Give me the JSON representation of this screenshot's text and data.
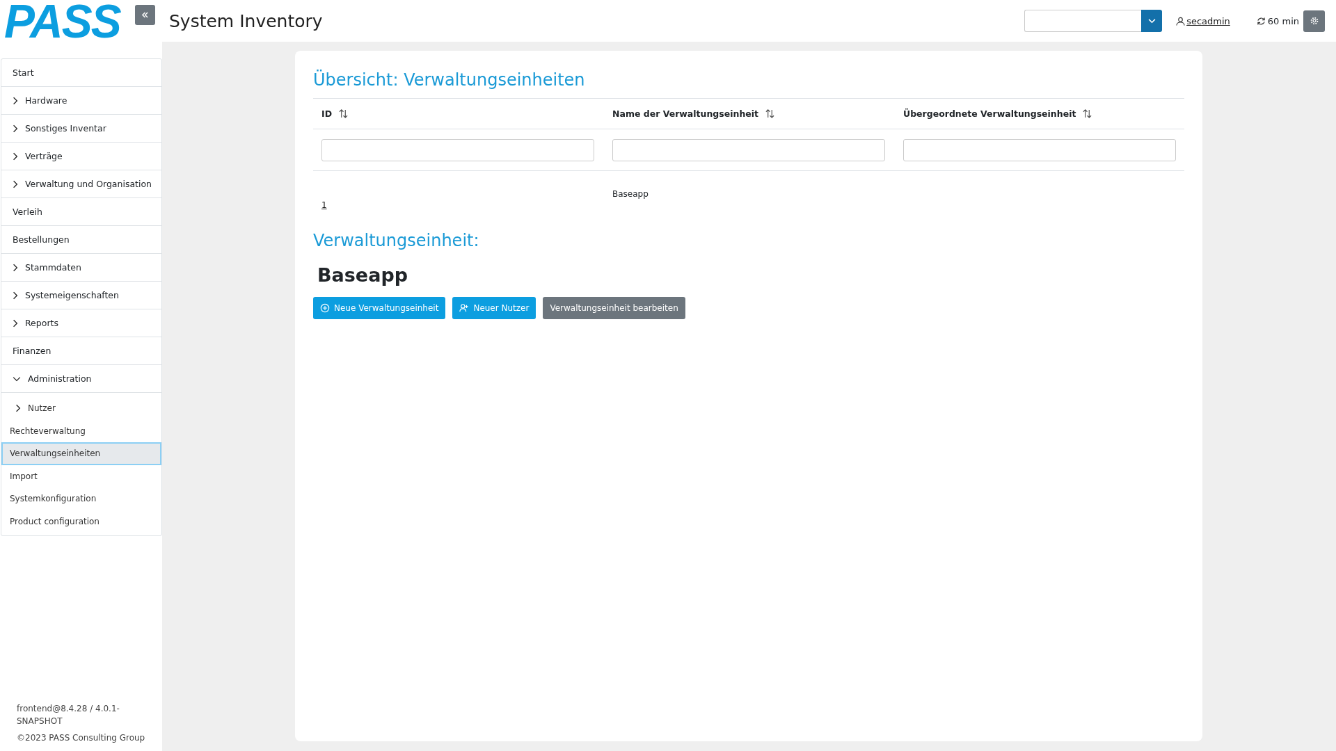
{
  "logo": "PASS",
  "header": {
    "title": "System Inventory",
    "user": "secadmin",
    "session": "60 min"
  },
  "sidebar": {
    "items": [
      {
        "label": "Start",
        "kind": "link",
        "selected": false
      },
      {
        "label": "Hardware",
        "kind": "group",
        "expanded": false,
        "selected": false
      },
      {
        "label": "Sonstiges Inventar",
        "kind": "group",
        "expanded": false,
        "selected": false
      },
      {
        "label": "Verträge",
        "kind": "group",
        "expanded": false,
        "selected": false
      },
      {
        "label": "Verwaltung und Organisation",
        "kind": "group",
        "expanded": false,
        "selected": false
      },
      {
        "label": "Verleih",
        "kind": "link",
        "selected": false
      },
      {
        "label": "Bestellungen",
        "kind": "link",
        "selected": false
      },
      {
        "label": "Stammdaten",
        "kind": "group",
        "expanded": false,
        "selected": false
      },
      {
        "label": "Systemeigenschaften",
        "kind": "group",
        "expanded": false,
        "selected": false
      },
      {
        "label": "Reports",
        "kind": "group",
        "expanded": false,
        "selected": false
      },
      {
        "label": "Finanzen",
        "kind": "link",
        "selected": false
      },
      {
        "label": "Administration",
        "kind": "group",
        "expanded": true,
        "selected": false,
        "children": [
          {
            "label": "Nutzer",
            "kind": "group",
            "expanded": false,
            "selected": false
          },
          {
            "label": "Rechteverwaltung",
            "kind": "link",
            "selected": false
          },
          {
            "label": "Verwaltungseinheiten",
            "kind": "link",
            "selected": true
          },
          {
            "label": "Import",
            "kind": "link",
            "selected": false
          },
          {
            "label": "Systemkonfiguration",
            "kind": "link",
            "selected": false
          },
          {
            "label": "Product configuration",
            "kind": "link",
            "selected": false
          }
        ]
      }
    ],
    "version": "frontend@8.4.28 / 4.0.1-SNAPSHOT",
    "copyright": "©2023 PASS Consulting Group"
  },
  "overview": {
    "title": "Übersicht: Verwaltungseinheiten",
    "columns": [
      {
        "label": "ID"
      },
      {
        "label": "Name der Verwaltungseinheit"
      },
      {
        "label": "Übergeordnete Verwaltungseinheit"
      }
    ],
    "rows": [
      {
        "id": "1",
        "name": "Baseapp"
      }
    ]
  },
  "detail": {
    "title": "Verwaltungseinheit:",
    "name": "Baseapp",
    "buttons": [
      {
        "label": "Neue Verwaltungseinheit",
        "kind": "primary"
      },
      {
        "label": "Neuer Nutzer",
        "kind": "primary"
      },
      {
        "label": "Verwaltungseinheit bearbeiten",
        "kind": "secondary"
      }
    ]
  }
}
